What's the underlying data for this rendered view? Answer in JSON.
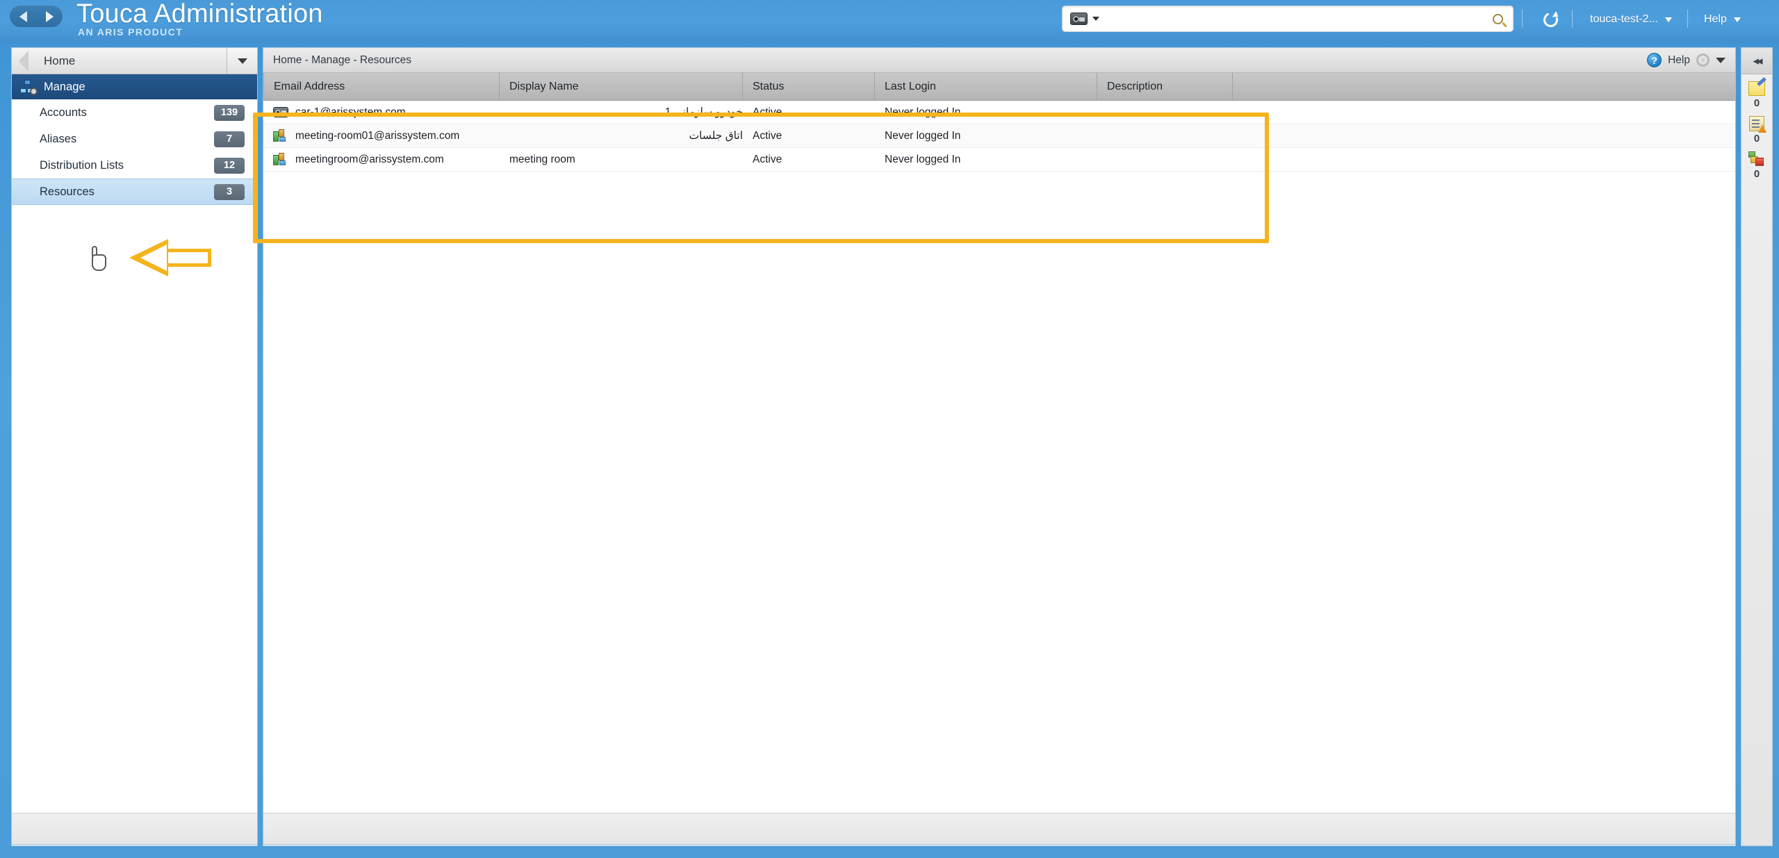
{
  "topbar": {
    "nav_back_icon": "triangle-left-icon",
    "nav_forward_icon": "triangle-right-icon",
    "brand_title": "Touca Administration",
    "brand_subtitle": "AN ARIS PRODUCT",
    "search": {
      "scope_icon": "resource-icon",
      "value": "",
      "placeholder": "",
      "search_icon": "magnifier-icon"
    },
    "refresh_icon": "refresh-icon",
    "user_menu": "touca-test-2...",
    "help_menu": "Help"
  },
  "sidebar": {
    "home_label": "Home",
    "group": {
      "label": "Manage",
      "icon": "manage-users-gear-icon"
    },
    "items": [
      {
        "label": "Accounts",
        "count": "139"
      },
      {
        "label": "Aliases",
        "count": "7"
      },
      {
        "label": "Distribution Lists",
        "count": "12"
      },
      {
        "label": "Resources",
        "count": "3"
      }
    ],
    "selected": "Resources"
  },
  "content": {
    "breadcrumb": "Home - Manage - Resources",
    "help_label": "Help",
    "help_icon": "question-circle-icon",
    "settings_icon": "gear-icon",
    "columns": [
      "Email Address",
      "Display Name",
      "Status",
      "Last Login",
      "Description"
    ],
    "rows": [
      {
        "icon": "car-resource-icon",
        "email": "car-1@arissystem.com",
        "display_name": "خودرو سازمانی 1",
        "status": "Active",
        "last_login": "Never logged In",
        "description": ""
      },
      {
        "icon": "room-resource-icon",
        "email": "meeting-room01@arissystem.com",
        "display_name": "اتاق جلسات",
        "status": "Active",
        "last_login": "Never logged In",
        "description": ""
      },
      {
        "icon": "room-resource-icon",
        "email": "meetingroom@arissystem.com",
        "display_name": "meeting room",
        "status": "Active",
        "last_login": "Never logged In",
        "description": ""
      }
    ]
  },
  "rail": {
    "collapse_icon": "collapse-left-icon",
    "items": [
      {
        "icon": "note-pen-icon",
        "count": "0"
      },
      {
        "icon": "clipboard-task-icon",
        "count": "0"
      },
      {
        "icon": "status-blocks-icon",
        "count": "0"
      }
    ]
  },
  "annotations": {
    "highlight_color": "#f5b31c",
    "arrow_target": "Resources",
    "rect_target": "resources-table"
  }
}
